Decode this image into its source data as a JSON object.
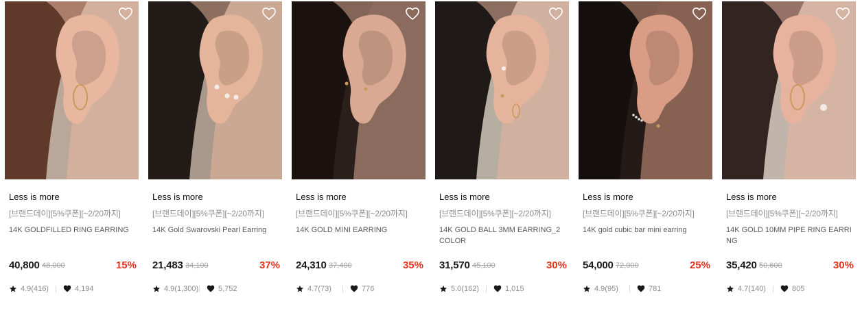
{
  "products": [
    {
      "brand": "Less is more",
      "promo": "[브랜드데이][5%쿠폰][~2/20까지]",
      "title": "14K GOLDFILLED RING EARRING",
      "price": "40,800",
      "original_price": "48,000",
      "discount": "15%",
      "rating": "4.9(416)",
      "likes": "4,194",
      "image": {
        "bg": "#b9a89a",
        "skin": "#e9b7a0",
        "hair": "#5a3324",
        "jewel": "hoop",
        "icon": "ear-photo"
      }
    },
    {
      "brand": "Less is more",
      "promo": "[브랜드데이][5%쿠폰][~2/20까지]",
      "title": "14K Gold Swarovski Pearl Earring",
      "price": "21,483",
      "original_price": "34,100",
      "discount": "37%",
      "rating": "4.9(1,300)",
      "likes": "5,752",
      "image": {
        "bg": "#a8998c",
        "skin": "#e5b59b",
        "hair": "#1b1411",
        "jewel": "pearls",
        "icon": "ear-photo"
      }
    },
    {
      "brand": "Less is more",
      "promo": "[브랜드데이][5%쿠폰][~2/20까지]",
      "title": "14K GOLD MINI EARRING",
      "price": "24,310",
      "original_price": "37,400",
      "discount": "35%",
      "rating": "4.7(73)",
      "likes": "776",
      "image": {
        "bg": "#2a1f1b",
        "skin": "#d9a993",
        "hair": "#1a1210",
        "jewel": "studs",
        "icon": "ear-photo"
      }
    },
    {
      "brand": "Less is more",
      "promo": "[브랜드데이][5%쿠폰][~2/20까지]",
      "title": "14K GOLD BALL 3MM EARRING_2 COLOR",
      "price": "31,570",
      "original_price": "45,100",
      "discount": "30%",
      "rating": "5.0(162)",
      "likes": "1,015",
      "image": {
        "bg": "#b7aea2",
        "skin": "#e6b49c",
        "hair": "#161110",
        "jewel": "ball",
        "icon": "ear-photo"
      }
    },
    {
      "brand": "Less is more",
      "promo": "[브랜드데이][5%쿠폰][~2/20까지]",
      "title": "14K gold cubic bar mini earring",
      "price": "54,000",
      "original_price": "72,000",
      "discount": "25%",
      "rating": "4.9(95)",
      "likes": "781",
      "image": {
        "bg": "#241b18",
        "skin": "#d99c85",
        "hair": "#15100e",
        "jewel": "bar",
        "icon": "ear-photo"
      }
    },
    {
      "brand": "Less is more",
      "promo": "[브랜드데이][5%쿠폰][~2/20까지]",
      "title": "14K GOLD 10MM PIPE RING EARRI NG",
      "price": "35,420",
      "original_price": "50,600",
      "discount": "30%",
      "rating": "4.7(140)",
      "likes": "805",
      "image": {
        "bg": "#c1b5ab",
        "skin": "#e7b39e",
        "hair": "#2a1e19",
        "jewel": "pipe",
        "icon": "ear-photo"
      }
    }
  ],
  "icons": {
    "wish": "heart-outline-icon",
    "star": "star-icon",
    "like": "heart-filled-icon"
  },
  "colors": {
    "discount": "#e2341d",
    "muted": "#8c8c8c"
  }
}
